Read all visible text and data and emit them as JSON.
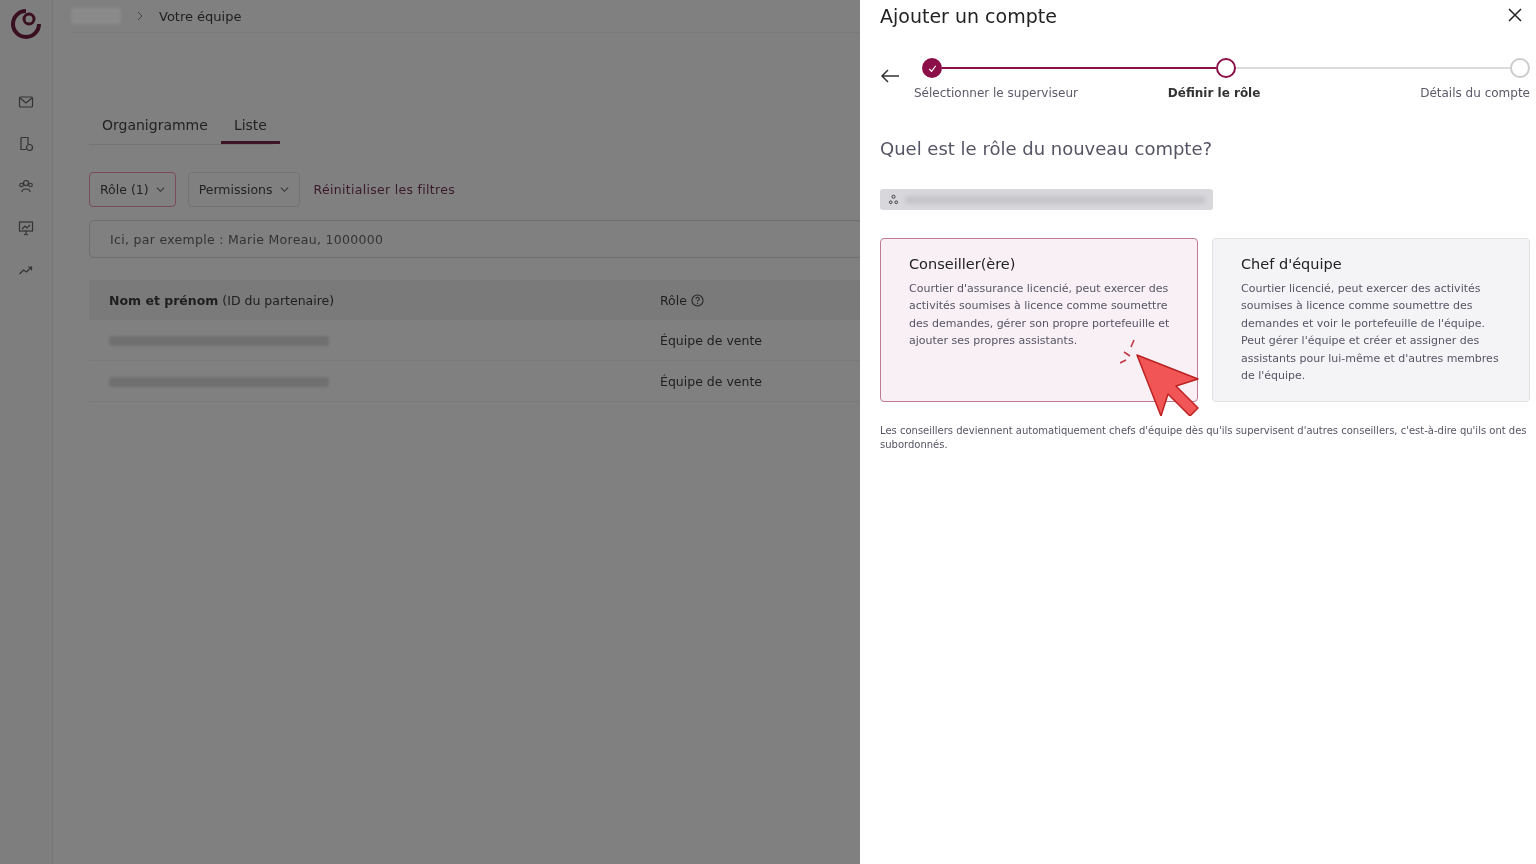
{
  "breadcrumb": {
    "current": "Votre équipe"
  },
  "tabs": [
    {
      "label": "Organigramme",
      "selected": false
    },
    {
      "label": "Liste",
      "selected": true
    }
  ],
  "filters": [
    {
      "label": "Rôle (1)",
      "active": true
    },
    {
      "label": "Permissions",
      "active": false
    }
  ],
  "reset_filters": "Réinitialiser les filtres",
  "search": {
    "placeholder": "Ici, par exemple : Marie Moreau, 1000000"
  },
  "table": {
    "columns": [
      "**Nom et prénom** (ID du partenaire)",
      "Rôle"
    ],
    "rows": [
      {
        "role": "Équipe de vente"
      },
      {
        "role": "Équipe de vente"
      }
    ]
  },
  "drawer": {
    "title": "Ajouter un compte",
    "steps": [
      {
        "label": "Sélectionner le superviseur",
        "completed": true,
        "selected": false
      },
      {
        "label": "Définir le rôle",
        "completed": false,
        "selected": true
      },
      {
        "label": "Détails du compte",
        "completed": false,
        "selected": false
      }
    ],
    "question": "Quel est le rôle du nouveau compte?",
    "roles": [
      {
        "title": "Conseiller(ère)",
        "description": "Courtier d'assurance licencié, peut exercer des activités soumises à licence comme soumettre des demandes, gérer son propre portefeuille et ajouter ses propres assistants.",
        "selected": true
      },
      {
        "title": "Chef d'équipe",
        "description": "Courtier licencié, peut exercer des activités soumises à licence comme soumettre des demandes et voir le portefeuille de l'équipe. Peut gérer l'équipe et créer et assigner des assistants pour lui-même et d'autres membres de l'équipe.",
        "selected": false
      }
    ],
    "note": "Les conseillers deviennent automatiquement chefs d'équipe dès qu'ils supervisent d'autres conseillers, c'est-à-dire qu'ils ont des subordonnés."
  }
}
